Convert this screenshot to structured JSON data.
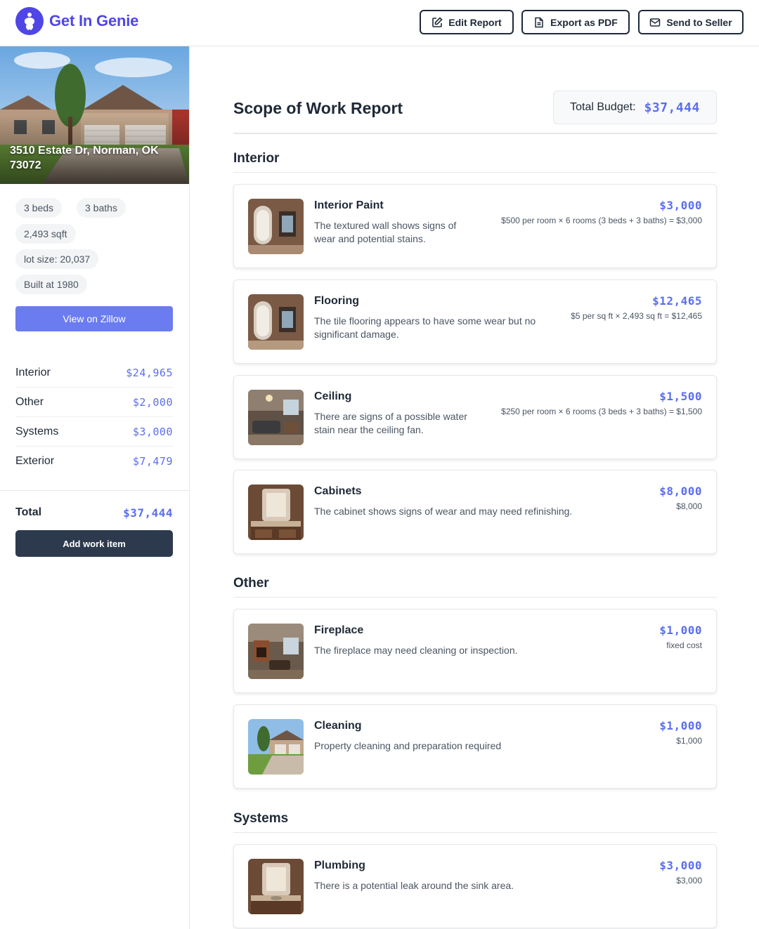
{
  "header": {
    "brand": "Get In Genie",
    "buttons": {
      "edit": "Edit Report",
      "export": "Export as PDF",
      "send": "Send to Seller"
    }
  },
  "property": {
    "address": "3510 Estate Dr, Norman, OK 73072",
    "beds": "3 beds",
    "baths": "3 baths",
    "sqft": "2,493 sqft",
    "lot": "lot size: 20,037",
    "built": "Built at 1980",
    "zillow_label": "View on Zillow"
  },
  "summary": {
    "categories": [
      {
        "label": "Interior",
        "amount": "$24,965"
      },
      {
        "label": "Other",
        "amount": "$2,000"
      },
      {
        "label": "Systems",
        "amount": "$3,000"
      },
      {
        "label": "Exterior",
        "amount": "$7,479"
      }
    ],
    "total_label": "Total",
    "total_amount": "$37,444",
    "add_label": "Add work item"
  },
  "report": {
    "title": "Scope of Work Report",
    "budget_label": "Total Budget:",
    "budget_amount": "$37,444"
  },
  "sections": [
    {
      "title": "Interior",
      "items": [
        {
          "title": "Interior Paint",
          "desc": "The textured wall shows signs of wear and potential stains.",
          "cost": "$3,000",
          "calc": "$500 per room × 6 rooms (3 beds + 3 baths) = $3,000"
        },
        {
          "title": "Flooring",
          "desc": "The tile flooring appears to have some wear but no significant damage.",
          "cost": "$12,465",
          "calc": "$5 per sq ft × 2,493 sq ft = $12,465"
        },
        {
          "title": "Ceiling",
          "desc": "There are signs of a possible water stain near the ceiling fan.",
          "cost": "$1,500",
          "calc": "$250 per room × 6 rooms (3 beds + 3 baths) = $1,500"
        },
        {
          "title": "Cabinets",
          "desc": "The cabinet shows signs of wear and may need refinishing.",
          "cost": "$8,000",
          "calc": "$8,000"
        }
      ]
    },
    {
      "title": "Other",
      "items": [
        {
          "title": "Fireplace",
          "desc": "The fireplace may need cleaning or inspection.",
          "cost": "$1,000",
          "calc": "fixed cost"
        },
        {
          "title": "Cleaning",
          "desc": "Property cleaning and preparation required",
          "cost": "$1,000",
          "calc": "$1,000"
        }
      ]
    },
    {
      "title": "Systems",
      "items": [
        {
          "title": "Plumbing",
          "desc": "There is a potential leak around the sink area.",
          "cost": "$3,000",
          "calc": "$3,000"
        }
      ]
    }
  ],
  "colors": {
    "brand": "#4f46e5",
    "accent_money": "#5b6ef0",
    "zillow_button": "#6b7cf0",
    "dark_button": "#2d3a4d"
  }
}
